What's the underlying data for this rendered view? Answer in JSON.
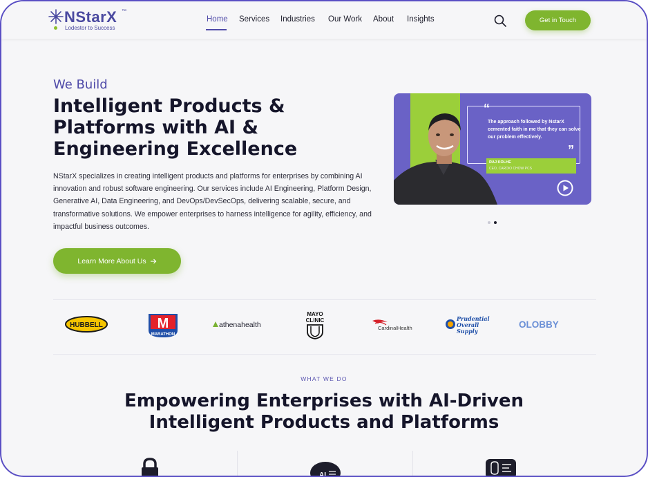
{
  "header": {
    "logo": {
      "name": "NStarX",
      "trademark": "™",
      "tagline": "Lodestor to Success"
    },
    "nav": [
      {
        "label": "Home",
        "active": true
      },
      {
        "label": "Services",
        "active": false
      },
      {
        "label": "Industries",
        "active": false
      },
      {
        "label": "Our Work",
        "active": false
      },
      {
        "label": "About",
        "active": false
      },
      {
        "label": "Insights",
        "active": false
      }
    ],
    "search_icon": "search-icon",
    "cta_label": "Get in Touch"
  },
  "hero": {
    "kicker": "We Build",
    "title_lines": [
      "Intelligent Products &",
      "Platforms with AI &",
      "Engineering Excellence"
    ],
    "description": "NStarX specializes in creating intelligent products and platforms for enterprises by combining AI innovation and robust software engineering. Our services include AI Engineering, Platform Design, Generative AI, Data Engineering, and DevOps/DevSecOps, delivering scalable, secure, and transformative solutions. We empower enterprises to harness intelligence for agility, efficiency, and impactful business outcomes.",
    "button_label": "Learn More About Us",
    "button_icon": "arrow-right-icon"
  },
  "testimonial": {
    "quote": "The approach followed by NstarX cemented faith in me that they can solve our problem effectively.",
    "name": "RAJ KOLHE",
    "role": "CEO, CARDIO CHOW PCS",
    "play_icon": "play-icon",
    "slides": 2,
    "active_slide": 2
  },
  "clients": {
    "logos": [
      {
        "name": "HUBBELL"
      },
      {
        "name": "M",
        "sub": "MARATHON"
      },
      {
        "name": "athenahealth"
      },
      {
        "name": "MAYO",
        "sub": "CLINIC"
      },
      {
        "name": "CardinalHealth"
      },
      {
        "name": "Prudential",
        "sub": "Overall Supply"
      },
      {
        "name": "OLOBBY"
      }
    ]
  },
  "what_we_do": {
    "kicker": "WHAT WE DO",
    "title_lines": [
      "Empowering Enterprises with AI-Driven",
      "Intelligent Products and Platforms"
    ],
    "service_icons": [
      "lock-icon",
      "ai-chip-icon",
      "brain-chip-icon"
    ]
  },
  "colors": {
    "brand_purple": "#4f4aa8",
    "brand_green": "#7fb52f",
    "card_purple": "#6a62c6"
  }
}
